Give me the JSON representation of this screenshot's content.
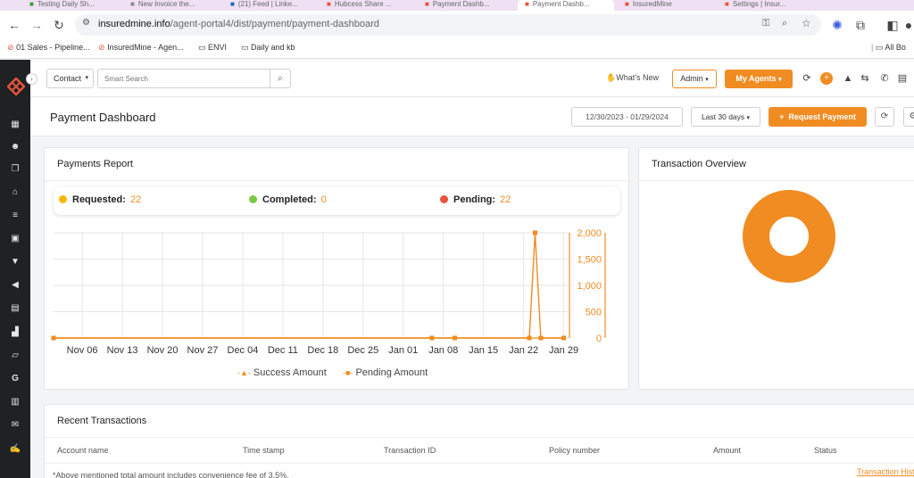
{
  "browser": {
    "tabs": [
      {
        "title": "Testing Daily Sh..."
      },
      {
        "title": "New Invoice the..."
      },
      {
        "title": "(21) Feed | Linke..."
      },
      {
        "title": "Hubcess Share ..."
      },
      {
        "title": "Payment Dashb..."
      },
      {
        "title": "Payment Dashb..."
      },
      {
        "title": "InsuredMine"
      },
      {
        "title": "Settings | Insur..."
      }
    ],
    "url_host": "insuredmine.info",
    "url_path": "/agent-portal4/dist/payment/payment-dashboard",
    "bookmarks": [
      "01 Sales - Pipeline...",
      "InsuredMine - Agen...",
      "ENVI",
      "Daily and kb"
    ],
    "all_bookmarks": "All Bo"
  },
  "header": {
    "contact_select": "Contact",
    "search_placeholder": "Smart Search",
    "whats_new": "What's New",
    "admin_label": "Admin",
    "agents_label": "My Agents"
  },
  "page": {
    "title": "Payment Dashboard",
    "date_range": "12/30/2023 - 01/29/2024",
    "range_select": "Last 30 days",
    "request_payment": "Request Payment"
  },
  "payments_report": {
    "title": "Payments Report",
    "requested_label": "Requested:",
    "requested_value": "22",
    "completed_label": "Completed:",
    "completed_value": "0",
    "pending_label": "Pending:",
    "pending_value": "22",
    "legend_success": "Success Amount",
    "legend_pending": "Pending Amount"
  },
  "transaction_overview": {
    "title": "Transaction Overview"
  },
  "recent_transactions": {
    "title": "Recent Transactions",
    "columns": [
      "Account name",
      "Time stamp",
      "Transaction ID",
      "Policy number",
      "Amount",
      "Status"
    ],
    "footnote": "*Above mentioned total amount includes convenience fee of 3.5%.",
    "history_link": "Transaction Histo"
  },
  "colors": {
    "accent": "#f08c22",
    "requested": "#f6b800",
    "completed": "#7ac943",
    "pending": "#e8533a",
    "sidebar": "#1f2124"
  },
  "chart_data": [
    {
      "type": "line",
      "x": [
        "Nov 06",
        "Nov 13",
        "Nov 20",
        "Nov 27",
        "Dec 04",
        "Dec 11",
        "Dec 18",
        "Dec 25",
        "Jan 01",
        "Jan 08",
        "Jan 15",
        "Jan 22",
        "Jan 29"
      ],
      "ylim": [
        0,
        2000
      ],
      "yticks": [
        "2,000",
        "1,500",
        "1,000",
        "500",
        "0"
      ],
      "grid": true,
      "legend": "bottom",
      "series": [
        {
          "name": "Success Amount",
          "points": [
            [
              "Nov 01",
              0
            ],
            [
              "Jan 29",
              0
            ]
          ]
        },
        {
          "name": "Pending Amount",
          "points": [
            [
              "Nov 01",
              0
            ],
            [
              "Jan 06",
              0
            ],
            [
              "Jan 10",
              0
            ],
            [
              "Jan 23",
              0
            ],
            [
              "Jan 24",
              2000
            ],
            [
              "Jan 25",
              0
            ],
            [
              "Jan 29",
              0
            ]
          ]
        }
      ]
    },
    {
      "type": "pie",
      "categories": [
        "Pending"
      ],
      "values": [
        22
      ],
      "donut": true
    }
  ]
}
